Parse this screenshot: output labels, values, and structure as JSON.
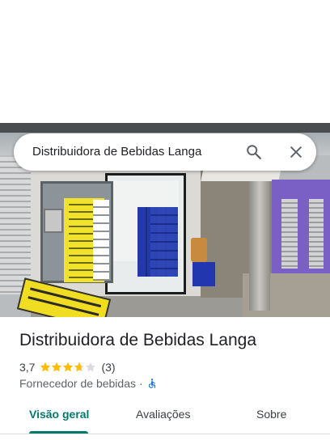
{
  "search": {
    "query": "Distribuidora de Bebidas Langa",
    "search_icon": "search-icon",
    "close_icon": "close-icon"
  },
  "photo": {
    "description_icon": "storefront-photo"
  },
  "place": {
    "name": "Distribuidora de Bebidas Langa",
    "rating": "3,7",
    "rating_value": 3.7,
    "rating_max": 5,
    "review_count": "(3)",
    "category": "Fornecedor de bebidas",
    "separator": "·",
    "accessibility_icon": "wheelchair-accessible-icon"
  },
  "tabs": [
    {
      "label": "Visão geral",
      "active": true
    },
    {
      "label": "Avaliações",
      "active": false
    },
    {
      "label": "Sobre",
      "active": false
    }
  ],
  "colors": {
    "accent": "#00796b",
    "star": "#fbbc04",
    "star_empty": "#dadce0",
    "accessibility": "#1a73e8"
  }
}
